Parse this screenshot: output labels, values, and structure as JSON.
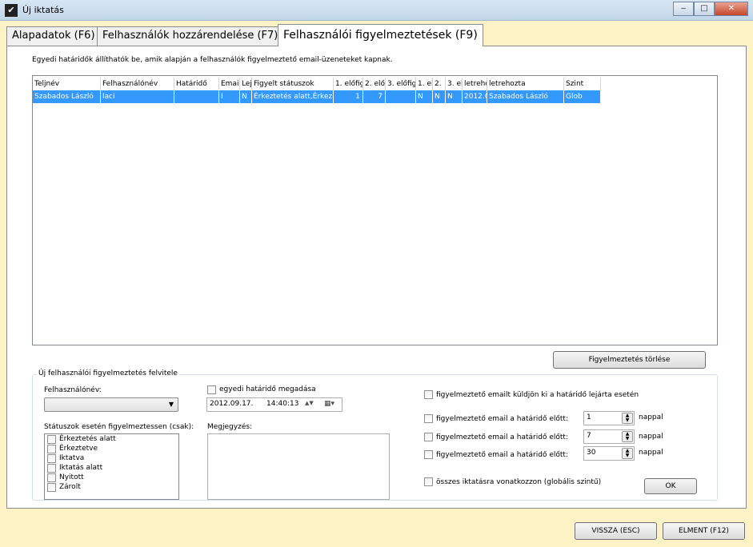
{
  "window": {
    "title": "Új iktatás",
    "app_icon": "dove-icon"
  },
  "tabs": [
    {
      "label": "Alapadatok (F6)"
    },
    {
      "label": "Felhasználók hozzárendelése (F7)"
    },
    {
      "label": "Felhasználói figyelmeztetések (F9)"
    }
  ],
  "info_text": "Egyedi határidők állíthatók be, amik alapján a felhasználók figyelmeztető email-üzeneteket kapnak.",
  "grid": {
    "headers": [
      "Teljnév",
      "Felhasználónév",
      "Határidő",
      "Email",
      "Lej",
      "Figyelt státuszok",
      "1. előfig",
      "2. elő",
      "3. előfig",
      "1. el",
      "2.",
      "3. el",
      "letrehc",
      "letrehozta",
      "Szint"
    ],
    "row": [
      "Szabados László",
      "laci",
      "",
      "I",
      "N",
      "Érkeztetés alatt,Érkez",
      "1",
      "7",
      "",
      "N",
      "N",
      "N",
      "2012.0",
      "Szabados László",
      "Glob"
    ]
  },
  "delete_button": "Figyelmeztetés törlése",
  "group": {
    "title": "Új felhasználói figyelmeztetés felvitele",
    "username_label": "Felhasználónév:",
    "custom_deadline_label": "egyedi határidő megadása",
    "date_value": "2012.09.17.",
    "time_value": "14:40:13",
    "status_label": "Státuszok esetén figyelmeztessen (csak):",
    "statuses": [
      "Érkeztetés alatt",
      "Érkeztetve",
      "Iktatva",
      "Iktatás alatt",
      "Nyitott",
      "Zárolt"
    ],
    "note_label": "Megjegyzés:",
    "expiry_email_label": "figyelmeztető emailt küldjön ki a határidő lejárta esetén",
    "before_label": "figyelmeztető email a határidő előtt:",
    "before_values": [
      "1",
      "7",
      "30"
    ],
    "days_label": "nappal",
    "global_label": "összes iktatásra vonatkozzon (globális szintű)",
    "ok_button": "OK"
  },
  "footer": {
    "back_button": "VISSZA (ESC)",
    "save_button": "ELMENT (F12)"
  }
}
